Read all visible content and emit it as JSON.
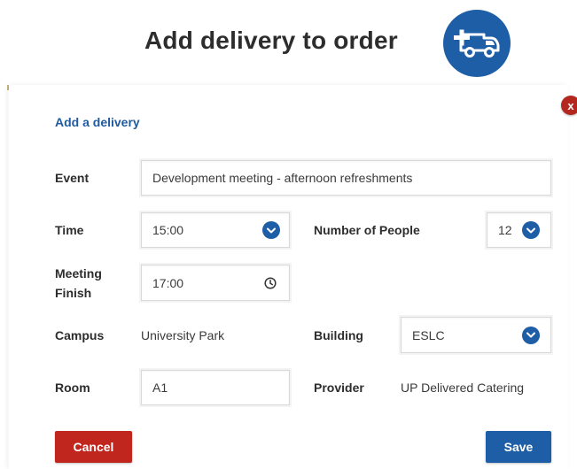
{
  "header": {
    "title": "Add delivery to order",
    "icon": "delivery-van-add-icon"
  },
  "form": {
    "section_title": "Add a delivery",
    "event": {
      "label": "Event",
      "value": "Development meeting - afternoon refreshments"
    },
    "time": {
      "label": "Time",
      "value": "15:00"
    },
    "number_of_people": {
      "label": "Number of People",
      "value": "12"
    },
    "meeting_finish": {
      "label_line1": "Meeting",
      "label_line2": "Finish",
      "value": "17:00"
    },
    "campus": {
      "label": "Campus",
      "value": "University Park"
    },
    "building": {
      "label": "Building",
      "value": "ESLC"
    },
    "room": {
      "label": "Room",
      "value": "A1"
    },
    "provider": {
      "label": "Provider",
      "value": "UP Delivered Catering"
    }
  },
  "actions": {
    "cancel_label": "Cancel",
    "save_label": "Save",
    "close_label": "x"
  },
  "colors": {
    "primary_blue": "#1d5ea6",
    "danger_red": "#c0251e",
    "link_blue": "#1f5b9e"
  }
}
